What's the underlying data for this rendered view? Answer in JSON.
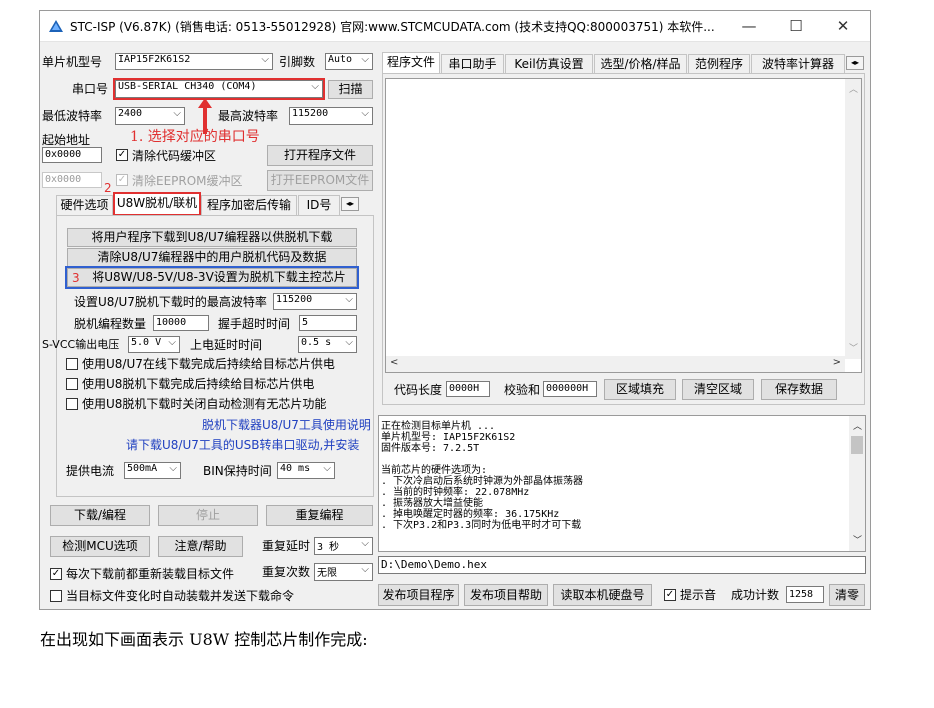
{
  "window": {
    "title": "STC-ISP (V6.87K) (销售电话: 0513-55012928) 官网:www.STCMCUDATA.com  (技术支持QQ:800003751) 本软件...",
    "minimize": "—",
    "maximize": "☐",
    "close": "✕"
  },
  "left": {
    "mcu_label": "单片机型号",
    "mcu_value": "IAP15F2K61S2",
    "pins_label": "引脚数",
    "pins_value": "Auto",
    "port_label": "串口号",
    "port_value": "USB-SERIAL CH340 (COM4)",
    "scan_button": "扫描",
    "min_baud_label": "最低波特率",
    "min_baud_value": "2400",
    "max_baud_label": "最高波特率",
    "max_baud_value": "115200",
    "start_addr_label": "起始地址",
    "annotation_1": "1. 选择对应的串口号",
    "code_addr": "0x0000",
    "clear_code_label": "清除代码缓冲区",
    "open_program_button": "打开程序文件",
    "eeprom_addr": "0x0000",
    "annotation_2": "2",
    "clear_eeprom_label": "清除EEPROM缓冲区",
    "open_eeprom_button": "打开EEPROM文件",
    "tabs": [
      "硬件选项",
      "U8W脱机/联机",
      "程序加密后传输",
      "ID号"
    ],
    "offline": {
      "btn_download_user": "将用户程序下载到U8/U7编程器以供脱机下载",
      "btn_clear_user": "清除U8/U7编程器中的用户脱机代码及数据",
      "annotation_3": "3",
      "btn_set_master": "将U8W/U8-5V/U8-3V设置为脱机下载主控芯片",
      "max_baud_label": "设置U8/U7脱机下载时的最高波特率",
      "max_baud_value": "115200",
      "count_label": "脱机编程数量",
      "count_value": "10000",
      "handshake_label": "握手超时时间",
      "handshake_value": "5",
      "svcc_label": "S-VCC输出电压",
      "svcc_value": "5.0 V",
      "delay_label": "上电延时时间",
      "delay_value": "0.5 s",
      "chk1": "使用U8/U7在线下载完成后持续给目标芯片供电",
      "chk2": "使用U8脱机下载完成后持续给目标芯片供电",
      "chk3": "使用U8脱机下载时关闭自动检测有无芯片功能",
      "link1": "脱机下载器U8/U7工具使用说明",
      "link2": "请下载U8/U7工具的USB转串口驱动,并安装",
      "current_label": "提供电流",
      "current_value": "500mA",
      "bin_label": "BIN保持时间",
      "bin_value": "40 ms"
    },
    "btn_download": "下载/编程",
    "btn_stop": "停止",
    "btn_reprogram": "重复编程",
    "btn_check_mcu": "检测MCU选项",
    "btn_help": "注意/帮助",
    "repeat_delay_label": "重复延时",
    "repeat_delay_value": "3 秒",
    "repeat_count_label": "重复次数",
    "repeat_count_value": "无限",
    "chk_reload": "每次下载前都重新装载目标文件",
    "chk_autosend": "当目标文件变化时自动装载并发送下载命令"
  },
  "right": {
    "tabs": [
      "程序文件",
      "串口助手",
      "Keil仿真设置",
      "选型/价格/样品",
      "范例程序",
      "波特率计算器"
    ],
    "code_len_label": "代码长度",
    "code_len_value": "0000H",
    "checksum_label": "校验和",
    "checksum_value": "000000H",
    "btn_fill": "区域填充",
    "btn_clear_area": "清空区域",
    "btn_save": "保存数据",
    "log": [
      "正在检测目标单片机 ...",
      "  单片机型号: IAP15F2K61S2",
      "  固件版本号: 7.2.5T",
      "",
      "当前芯片的硬件选项为:",
      "  . 下次冷启动后系统时钟源为外部晶体振荡器",
      "  . 当前的时钟频率: 22.078MHz",
      "  . 振荡器放大增益使能",
      "  . 掉电唤醒定时器的频率: 36.175KHz",
      "  . 下次P3.2和P3.3同时为低电平时才可下载"
    ],
    "file_path": "D:\\Demo\\Demo.hex",
    "btn_publish": "发布项目程序",
    "btn_publish_help": "发布项目帮助",
    "btn_read_disk": "读取本机硬盘号",
    "chk_sound": "提示音",
    "success_label": "成功计数",
    "success_value": "1258",
    "btn_reset": "清零"
  },
  "caption": "在出现如下画面表示 U8W 控制芯片制作完成:"
}
